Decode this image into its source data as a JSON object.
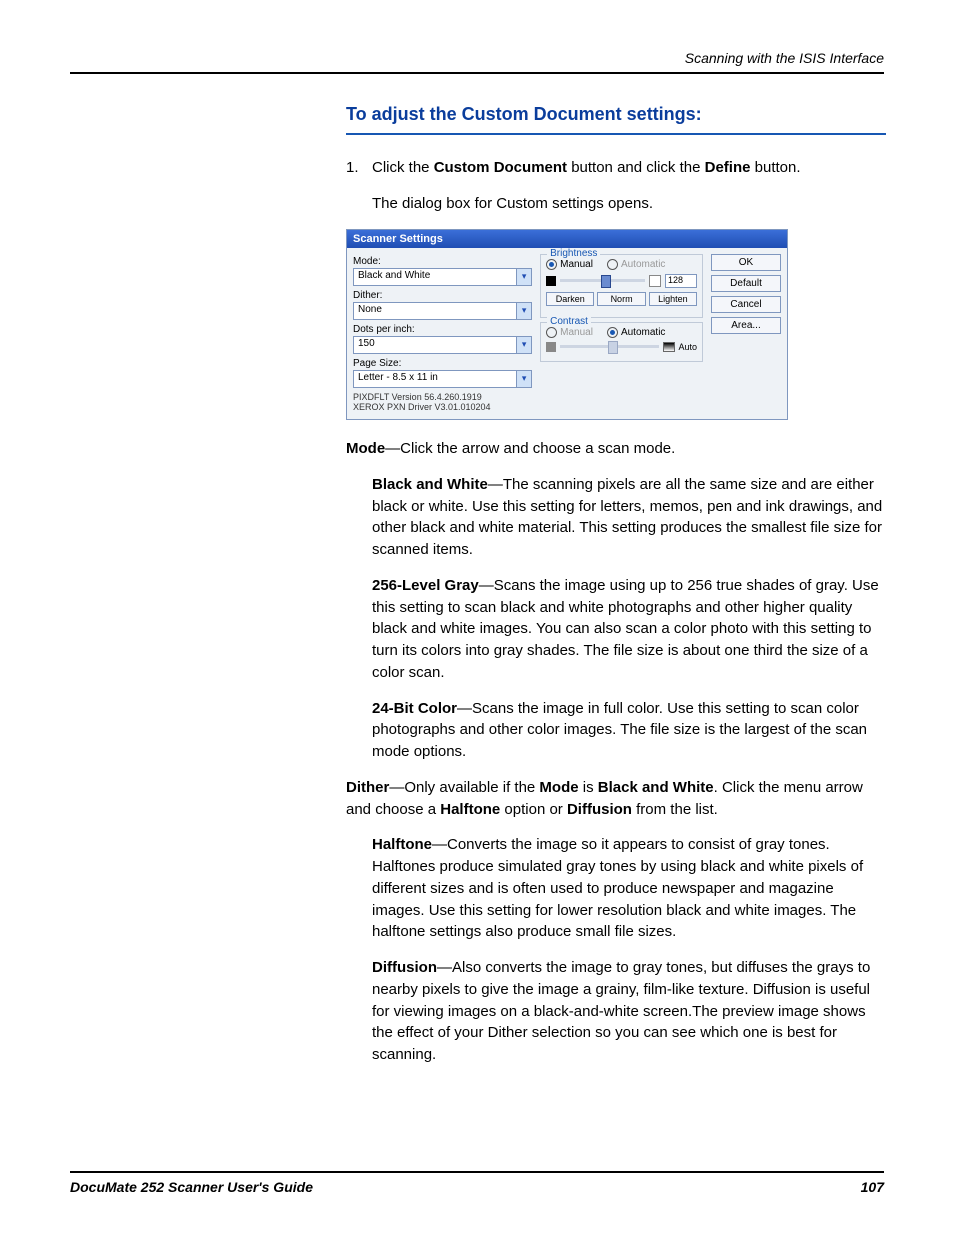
{
  "header": {
    "running": "Scanning with the ISIS Interface"
  },
  "section": {
    "title": "To adjust the Custom Document settings:"
  },
  "step1": {
    "num": "1.",
    "pre": "Click the ",
    "b1": "Custom Document",
    "mid": " button and click the ",
    "b2": "Define",
    "post": " button."
  },
  "intro2": "The dialog box for Custom settings opens.",
  "shot": {
    "title": "Scanner Settings",
    "left": {
      "mode_lbl": "Mode:",
      "mode_val": "Black and White",
      "dither_lbl": "Dither:",
      "dither_val": "None",
      "dpi_lbl": "Dots per inch:",
      "dpi_val": "150",
      "page_lbl": "Page Size:",
      "page_val": "Letter - 8.5 x 11 in",
      "ver1": "PIXDFLT Version 56.4.260.1919",
      "ver2": "XEROX PXN Driver V3.01.010204"
    },
    "mid": {
      "brightness": "Brightness",
      "manual": "Manual",
      "automatic": "Automatic",
      "value128": "128",
      "darken": "Darken",
      "norm": "Norm",
      "lighten": "Lighten",
      "contrast": "Contrast",
      "auto": "Auto"
    },
    "right": {
      "ok": "OK",
      "default": "Default",
      "cancel": "Cancel",
      "area": "Area..."
    }
  },
  "p_mode": {
    "b": "Mode",
    "rest": "—Click the arrow and choose a scan mode."
  },
  "p_bw": {
    "b": "Black and White",
    "rest": "—The scanning pixels are all the same size and are either black or white. Use this setting for letters, memos, pen and ink drawings, and other black and white material. This setting produces the smallest file size for scanned items."
  },
  "p_256": {
    "b": "256-Level Gray",
    "rest": "—Scans the image using up to 256 true shades of gray. Use this setting to scan black and white photographs and other higher quality black and white images. You can also scan a color photo with this setting to turn its colors into gray shades. The file size is about one third the size of a color scan."
  },
  "p_24": {
    "b": "24-Bit Color",
    "rest": "—Scans the image in full color. Use this setting to scan color photographs and other color images. The file size is the largest of the scan mode options."
  },
  "p_dither": {
    "b1": "Dither",
    "t1": "—Only available if the ",
    "b2": "Mode",
    "t2": " is ",
    "b3": "Black and White",
    "t3": ". Click the menu arrow and choose a ",
    "b4": "Halftone",
    "t4": " option or ",
    "b5": "Diffusion",
    "t5": " from the list."
  },
  "p_halftone": {
    "b": "Halftone",
    "rest": "—Converts the image so it appears to consist of gray tones. Halftones produce simulated gray tones by using black and white pixels of different sizes and is often used to produce newspaper and magazine images. Use this setting for lower resolution black and white images. The halftone settings also produce small file sizes."
  },
  "p_diffusion": {
    "b": "Diffusion",
    "rest": "—Also converts the image to gray tones, but diffuses the grays to nearby pixels to give the image a grainy, film-like texture. Diffusion is useful for viewing images on a black-and-white screen.The preview image shows the effect of your Dither selection so you can see which one is best for scanning."
  },
  "footer": {
    "left": "DocuMate 252 Scanner User's Guide",
    "right": "107"
  }
}
